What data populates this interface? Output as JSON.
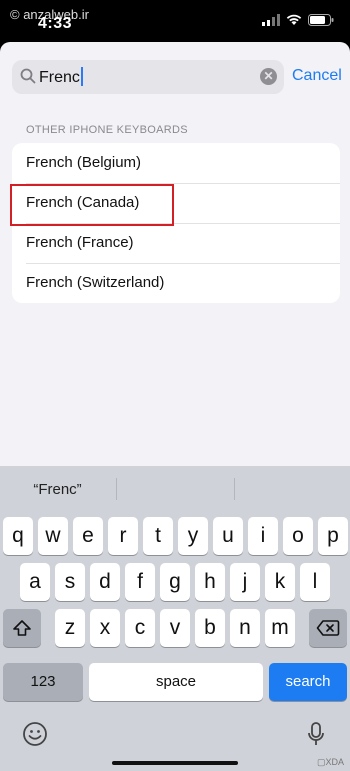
{
  "status_bar": {
    "watermark": "© anzalweb.ir",
    "time": "4:33"
  },
  "search": {
    "query": "Frenc",
    "cancel_label": "Cancel"
  },
  "section": {
    "header": "OTHER IPHONE KEYBOARDS"
  },
  "keyboards": [
    {
      "label": "French (Belgium)"
    },
    {
      "label": "French (Canada)"
    },
    {
      "label": "French (France)"
    },
    {
      "label": "French (Switzerland)"
    }
  ],
  "suggestion": {
    "text": "“Frenc”"
  },
  "keys": {
    "row1": [
      "q",
      "w",
      "e",
      "r",
      "t",
      "y",
      "u",
      "i",
      "o",
      "p"
    ],
    "row2": [
      "a",
      "s",
      "d",
      "f",
      "g",
      "h",
      "j",
      "k",
      "l"
    ],
    "row3": [
      "z",
      "x",
      "c",
      "v",
      "b",
      "n",
      "m"
    ],
    "numbers_label": "123",
    "space_label": "space",
    "search_label": "search"
  },
  "corner_logo": "▢XDA",
  "colors": {
    "accent": "#1d7cf2",
    "highlight": "#d32027"
  }
}
